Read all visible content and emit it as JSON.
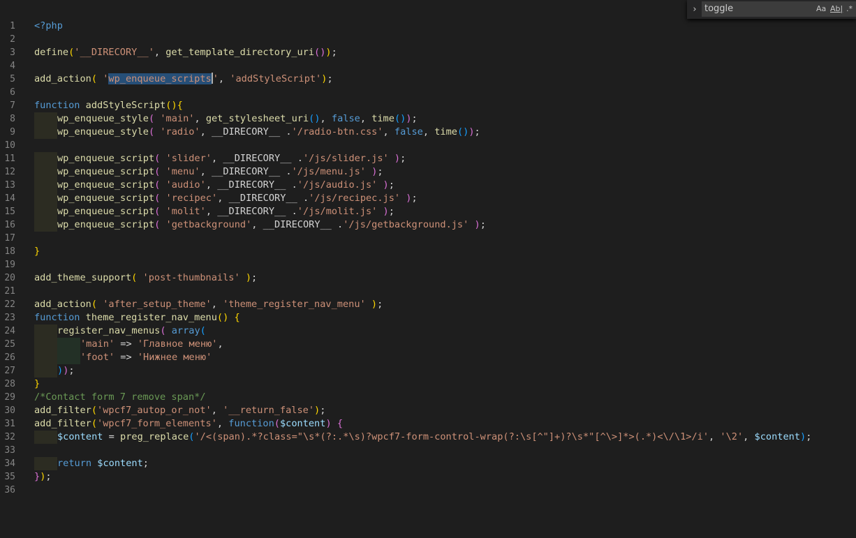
{
  "find": {
    "toggle_icon": "chevron-right",
    "query": "toggle",
    "match_case": "Aa",
    "whole_word": "Ab|",
    "regex": ".*"
  },
  "editor": {
    "line_numbers": [
      "1",
      "2",
      "3",
      "4",
      "5",
      "6",
      "7",
      "8",
      "9",
      "10",
      "11",
      "12",
      "13",
      "14",
      "15",
      "16",
      "17",
      "18",
      "19",
      "20",
      "21",
      "22",
      "23",
      "24",
      "25",
      "26",
      "27",
      "28",
      "29",
      "30",
      "31",
      "32",
      "33",
      "34",
      "35",
      "36"
    ],
    "colors": {
      "keyword": "#569cd6",
      "function": "#dcdcaa",
      "string": "#ce9178",
      "variable": "#9cdcfe",
      "comment": "#6a9955",
      "bracket_gold": "#ffd700",
      "bracket_pink": "#da70d6",
      "bracket_blue": "#179fff",
      "selection": "#264f78"
    },
    "lines": [
      "<?php",
      "",
      "define('__DIRECORY__', get_template_directory_uri());",
      "",
      "add_action( 'wp_enqueue_scripts', 'addStyleScript');",
      "",
      "function addStyleScript(){",
      "    wp_enqueue_style( 'main', get_stylesheet_uri(), false, time());",
      "    wp_enqueue_style( 'radio', __DIRECORY__ .'/radio-btn.css', false, time());",
      "",
      "    wp_enqueue_script( 'slider', __DIRECORY__ .'/js/slider.js' );",
      "    wp_enqueue_script( 'menu', __DIRECORY__ .'/js/menu.js' );",
      "    wp_enqueue_script( 'audio', __DIRECORY__ .'/js/audio.js' );",
      "    wp_enqueue_script( 'recipec', __DIRECORY__ .'/js/recipec.js' );",
      "    wp_enqueue_script( 'molit', __DIRECORY__ .'/js/molit.js' );",
      "    wp_enqueue_script( 'getbackground', __DIRECORY__ .'/js/getbackground.js' );",
      "",
      "}",
      "",
      "add_theme_support( 'post-thumbnails' );",
      "",
      "add_action( 'after_setup_theme', 'theme_register_nav_menu' );",
      "function theme_register_nav_menu() {",
      "    register_nav_menus( array(",
      "        'main' => 'Главное меню',",
      "        'foot' => 'Нижнее меню'",
      "    ));",
      "}",
      "/*Contact form 7 remove span*/",
      "add_filter('wpcf7_autop_or_not', '__return_false');",
      "add_filter('wpcf7_form_elements', function($content) {",
      "    $content = preg_replace('/<(span).*?class=\"\\s*(?:.*\\s)?wpcf7-form-control-wrap(?:\\s[^\"]+)?\\s*\"[^\\>]*>(.*)<\\/\\1>/i', '\\2', $content);",
      "",
      "    return $content;",
      "});",
      ""
    ]
  }
}
